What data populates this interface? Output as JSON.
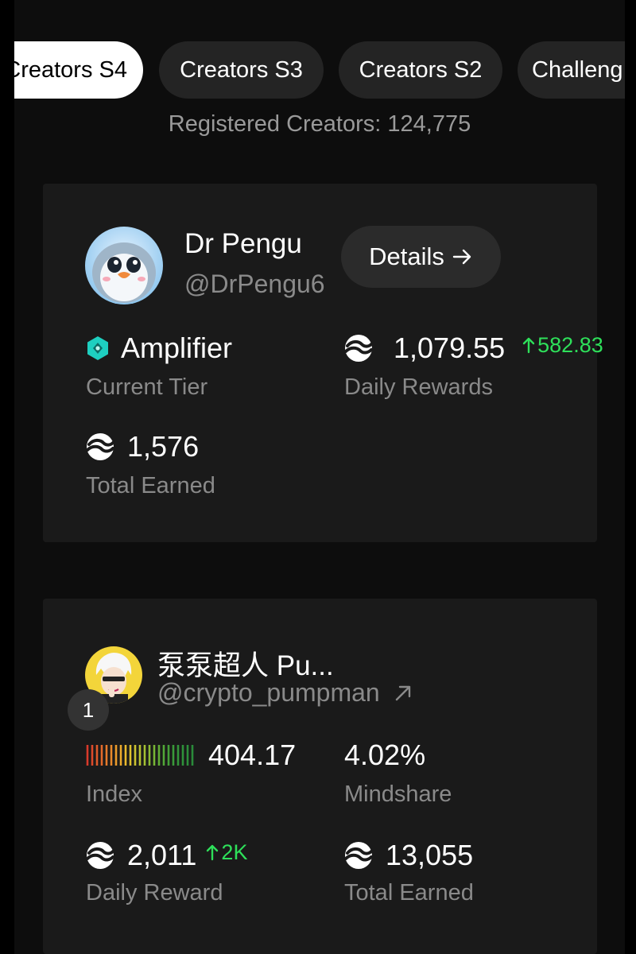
{
  "tabs": [
    {
      "label": "Creators S4",
      "active": true
    },
    {
      "label": "Creators S3",
      "active": false
    },
    {
      "label": "Creators S2",
      "active": false
    },
    {
      "label": "Challeng",
      "active": false
    }
  ],
  "registered": "Registered Creators: 124,775",
  "profile_card": {
    "name": "Dr Pengu",
    "handle": "@DrPengu6",
    "details_label": "Details",
    "tier_value": "Amplifier",
    "tier_label": "Current Tier",
    "daily_rewards_value": "1,079.55",
    "daily_rewards_change": "582.83",
    "daily_rewards_label": "Daily Rewards",
    "total_earned_value": "1,576",
    "total_earned_label": "Total Earned"
  },
  "leader_card": {
    "rank": "1",
    "name": "泵泵超人 Pu...",
    "handle": "@crypto_pumpman",
    "index_value": "404.17",
    "index_label": "Index",
    "mindshare_value": "4.02%",
    "mindshare_label": "Mindshare",
    "daily_reward_value": "2,011",
    "daily_reward_change": "2K",
    "daily_reward_label": "Daily Reward",
    "total_earned_value": "13,055",
    "total_earned_label": "Total Earned"
  },
  "colors": {
    "positive": "#2ee05a",
    "tier_icon": "#1ecfc0",
    "card_bg": "#1a1a1a"
  },
  "icons": [
    "token-icon",
    "tier-diamond-icon",
    "arrow-right-icon",
    "arrow-up-icon",
    "external-link-icon",
    "index-meter-icon"
  ]
}
